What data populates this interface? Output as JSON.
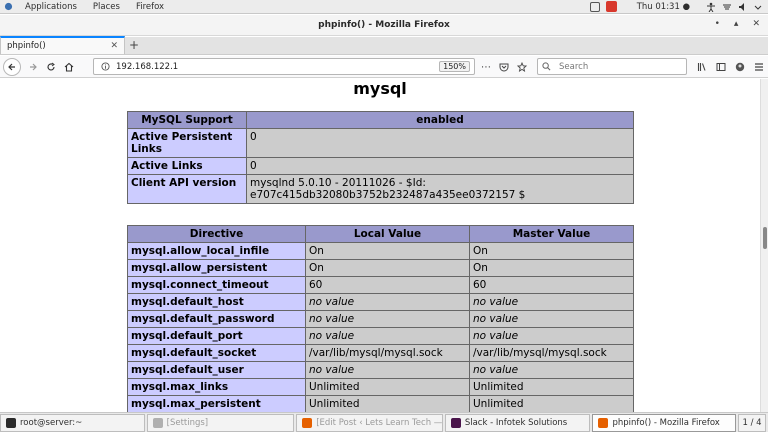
{
  "topbar": {
    "menus": [
      "Applications",
      "Places",
      "Firefox"
    ],
    "clock": "Thu 01:31 ●"
  },
  "window": {
    "title": "phpinfo() - Mozilla Firefox"
  },
  "tab": {
    "label": "phpinfo()"
  },
  "navbar": {
    "url": "192.168.122.1",
    "zoom": "150%",
    "search_placeholder": "Search"
  },
  "page": {
    "heading": "mysql",
    "support_table": {
      "header": [
        "MySQL Support",
        "enabled"
      ],
      "rows": [
        [
          "Active Persistent Links",
          "0"
        ],
        [
          "Active Links",
          "0"
        ],
        [
          "Client API version",
          "mysqlnd 5.0.10 - 20111026 - $Id: e707c415db32080b3752b232487a435ee0372157 $"
        ]
      ]
    },
    "directive_table": {
      "header": [
        "Directive",
        "Local Value",
        "Master Value"
      ],
      "rows": [
        [
          "mysql.allow_local_infile",
          "On",
          "On"
        ],
        [
          "mysql.allow_persistent",
          "On",
          "On"
        ],
        [
          "mysql.connect_timeout",
          "60",
          "60"
        ],
        [
          "mysql.default_host",
          "no value",
          "no value"
        ],
        [
          "mysql.default_password",
          "no value",
          "no value"
        ],
        [
          "mysql.default_port",
          "no value",
          "no value"
        ],
        [
          "mysql.default_socket",
          "/var/lib/mysql/mysql.sock",
          "/var/lib/mysql/mysql.sock"
        ],
        [
          "mysql.default_user",
          "no value",
          "no value"
        ],
        [
          "mysql.max_links",
          "Unlimited",
          "Unlimited"
        ],
        [
          "mysql.max_persistent",
          "Unlimited",
          "Unlimited"
        ]
      ]
    }
  },
  "taskbar": {
    "items": [
      {
        "label": "root@server:~",
        "icon_color": "#2b2b2b"
      },
      {
        "label": "[Settings]",
        "icon_color": "#b0b0b0"
      },
      {
        "label": "[Edit Post ‹ Lets Learn Tech — Wor...",
        "icon_color": "#e66000"
      },
      {
        "label": "Slack - Infotek Solutions",
        "icon_color": "#4a154b"
      },
      {
        "label": "phpinfo() - Mozilla Firefox",
        "icon_color": "#e66000"
      }
    ],
    "workspace": "1 / 4"
  },
  "colors": {
    "php_header": "#9999cc",
    "php_key": "#ccccff",
    "php_value": "#cccccc",
    "tab_accent": "#0a84ff"
  }
}
